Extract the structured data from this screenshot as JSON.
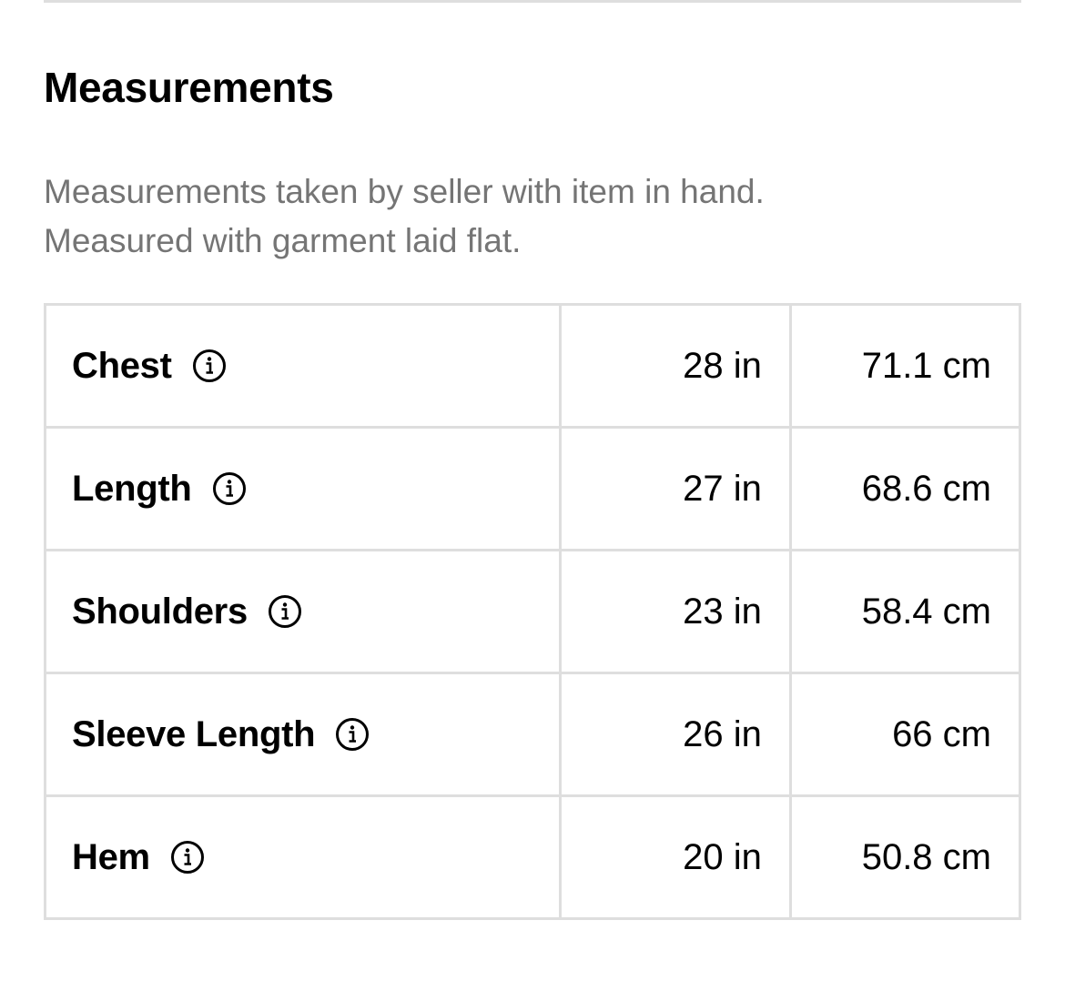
{
  "section": {
    "title": "Measurements",
    "description_lines": [
      "Measurements taken by seller with item in hand.",
      "Measured with garment laid flat."
    ]
  },
  "measurements": [
    {
      "label": "Chest",
      "in": "28 in",
      "cm": "71.1 cm",
      "icon": "info-icon"
    },
    {
      "label": "Length",
      "in": "27 in",
      "cm": "68.6 cm",
      "icon": "info-icon"
    },
    {
      "label": "Shoulders",
      "in": "23 in",
      "cm": "58.4 cm",
      "icon": "info-icon"
    },
    {
      "label": "Sleeve Length",
      "in": "26 in",
      "cm": "66 cm",
      "icon": "info-icon"
    },
    {
      "label": "Hem",
      "in": "20 in",
      "cm": "50.8 cm",
      "icon": "info-icon"
    }
  ],
  "colors": {
    "text": "#000000",
    "muted_text": "#757575",
    "border": "#dedede"
  }
}
